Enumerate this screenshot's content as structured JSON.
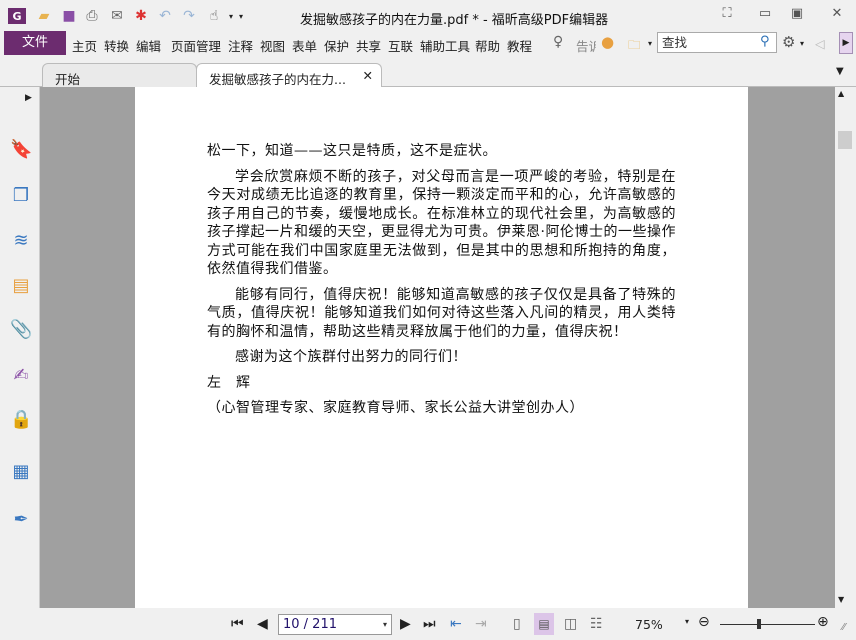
{
  "window": {
    "title": "发掘敏感孩子的内在力量.pdf * - 福昕高级PDF编辑器"
  },
  "menu": {
    "file": "文件",
    "items": [
      "主页",
      "转换",
      "编辑",
      "页面管理",
      "注释",
      "视图",
      "表单",
      "保护",
      "共享",
      "互联",
      "辅助工具",
      "帮助",
      "教程"
    ],
    "tell_me": "告诉",
    "search_placeholder": "查找"
  },
  "tabs": [
    {
      "label": "开始"
    },
    {
      "label": "发掘敏感孩子的内在力..."
    }
  ],
  "document": {
    "paragraphs": [
      "松一下，知道——这只是特质，这不是症状。",
      "学会欣赏麻烦不断的孩子，对父母而言是一项严峻的考验，特别是在今天对成绩无比追逐的教育里，保持一颗淡定而平和的心，允许高敏感的孩子用自己的节奏，缓慢地成长。在标准林立的现代社会里，为高敏感的孩子撑起一片和缓的天空，更显得尤为可贵。伊莱恩·阿伦博士的一些操作方式可能在我们中国家庭里无法做到，但是其中的思想和所抱持的角度，依然值得我们借鉴。",
      "能够有同行，值得庆祝！能够知道高敏感的孩子仅仅是具备了特殊的气质，值得庆祝！能够知道我们如何对待这些落入凡间的精灵，用人类特有的胸怀和温情，帮助这些精灵释放属于他们的力量，值得庆祝！",
      "感谢为这个族群付出努力的同行们！"
    ],
    "signature": "左　辉",
    "affiliation": "（心智管理专家、家庭教育导师、家长公益大讲堂创办人）"
  },
  "status": {
    "page": "10 / 211",
    "zoom": "75%",
    "zoom_fraction": 0.4
  },
  "colors": {
    "brand": "#6c2c6f"
  }
}
